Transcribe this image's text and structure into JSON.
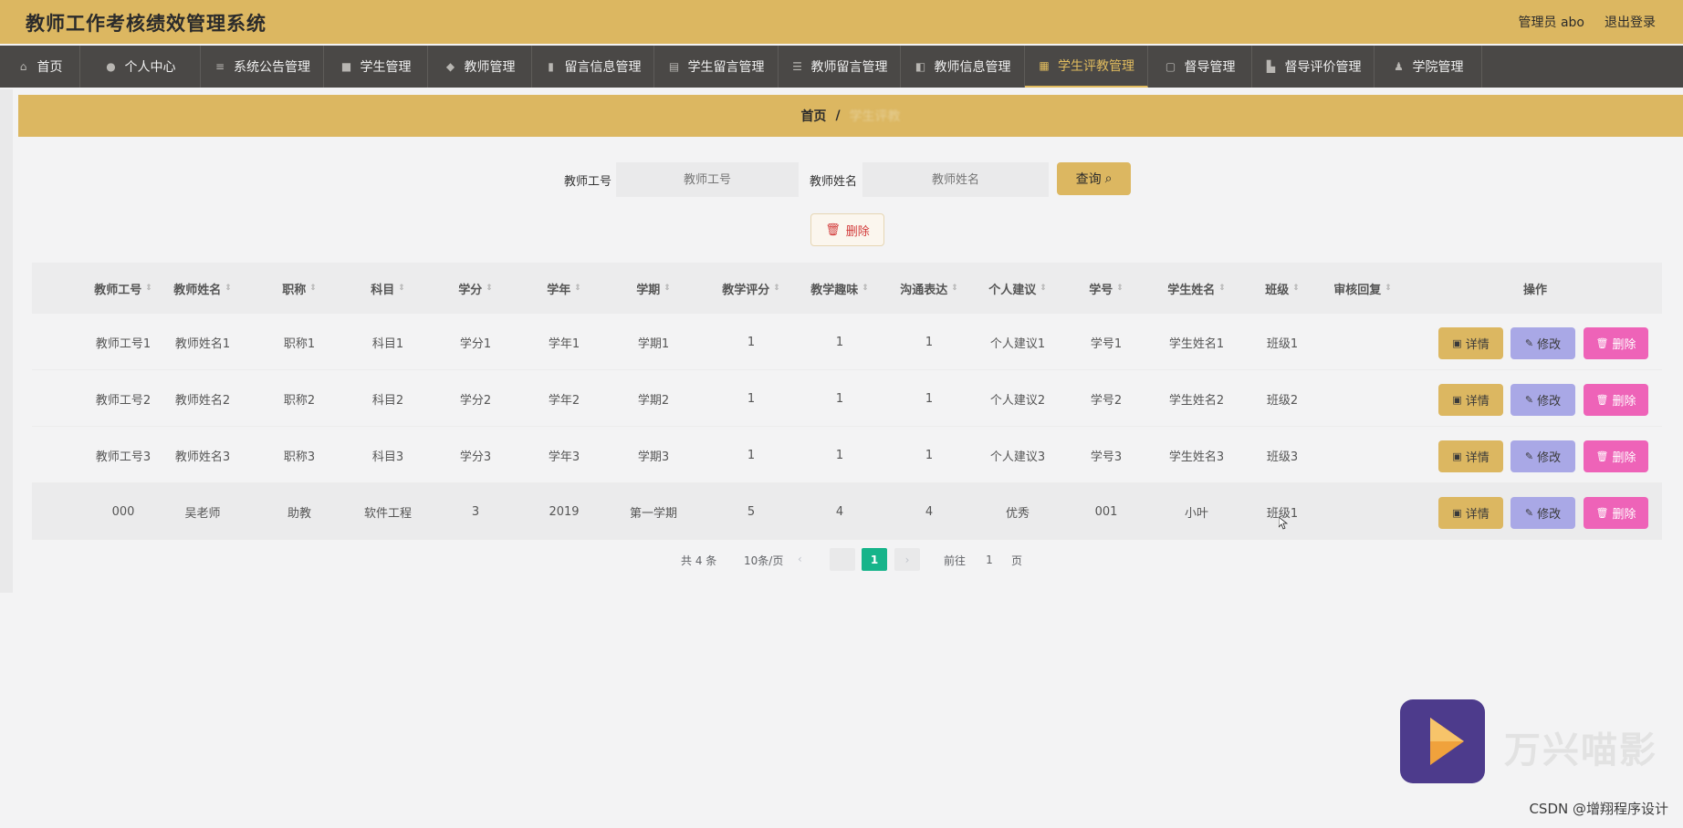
{
  "header": {
    "title": "教师工作考核绩效管理系统",
    "admin_label": "管理员 abo",
    "logout_label": "退出登录"
  },
  "nav": [
    {
      "label": "首页",
      "icon": "home-icon",
      "glyph": "⌂"
    },
    {
      "label": "个人中心",
      "icon": "user-icon",
      "glyph": "●"
    },
    {
      "label": "系统公告管理",
      "icon": "list-icon",
      "glyph": "≡"
    },
    {
      "label": "学生管理",
      "icon": "square-icon",
      "glyph": "■"
    },
    {
      "label": "教师管理",
      "icon": "shield-icon",
      "glyph": "◆"
    },
    {
      "label": "留言信息管理",
      "icon": "bar-chart-icon",
      "glyph": "▮"
    },
    {
      "label": "学生留言管理",
      "icon": "document-icon",
      "glyph": "▤"
    },
    {
      "label": "教师留言管理",
      "icon": "list-icon",
      "glyph": "☰"
    },
    {
      "label": "教师信息管理",
      "icon": "chart-icon",
      "glyph": "◧"
    },
    {
      "label": "学生评教管理",
      "icon": "book-icon",
      "glyph": "▦"
    },
    {
      "label": "督导管理",
      "icon": "chat-icon",
      "glyph": "▢"
    },
    {
      "label": "督导评价管理",
      "icon": "cart-icon",
      "glyph": "▙"
    },
    {
      "label": "学院管理",
      "icon": "person-icon",
      "glyph": "♟"
    }
  ],
  "breadcrumb": {
    "home": "首页",
    "sep": "/",
    "current": "学生评教"
  },
  "search": {
    "teacher_no_label": "教师工号",
    "teacher_no_placeholder": "教师工号",
    "teacher_name_label": "教师姓名",
    "teacher_name_placeholder": "教师姓名",
    "query_label": "查询"
  },
  "delete_label": "删除",
  "table": {
    "columns": [
      "教师工号",
      "教师姓名",
      "职称",
      "科目",
      "学分",
      "学年",
      "学期",
      "教学评分",
      "教学趣味",
      "沟通表达",
      "个人建议",
      "学号",
      "学生姓名",
      "班级",
      "审核回复"
    ],
    "actions_header": "操作",
    "rows": [
      [
        "教师工号1",
        "教师姓名1",
        "职称1",
        "科目1",
        "学分1",
        "学年1",
        "学期1",
        "1",
        "1",
        "1",
        "个人建议1",
        "学号1",
        "学生姓名1",
        "班级1",
        ""
      ],
      [
        "教师工号2",
        "教师姓名2",
        "职称2",
        "科目2",
        "学分2",
        "学年2",
        "学期2",
        "1",
        "1",
        "1",
        "个人建议2",
        "学号2",
        "学生姓名2",
        "班级2",
        ""
      ],
      [
        "教师工号3",
        "教师姓名3",
        "职称3",
        "科目3",
        "学分3",
        "学年3",
        "学期3",
        "1",
        "1",
        "1",
        "个人建议3",
        "学号3",
        "学生姓名3",
        "班级3",
        ""
      ],
      [
        "000",
        "吴老师",
        "助教",
        "软件工程",
        "3",
        "2019",
        "第一学期",
        "5",
        "4",
        "4",
        "优秀",
        "001",
        "小叶",
        "班级1",
        ""
      ]
    ],
    "detail_label": "详情",
    "edit_label": "修改",
    "row_delete_label": "删除"
  },
  "pagination": {
    "total": "共 4 条",
    "page_size": "10条/页",
    "prev": "‹",
    "current_page": "1",
    "next": "›",
    "goto_prefix": "前往",
    "goto_value": "1",
    "goto_suffix": "页"
  },
  "watermark": {
    "text": "万兴喵影",
    "credit": "CSDN @增翔程序设计"
  },
  "colors": {
    "accent": "#dcb761",
    "nav_bg": "#4a4846",
    "pager_active": "#16b48a",
    "edit": "#a9a8e6",
    "delete": "#ee63b8"
  }
}
